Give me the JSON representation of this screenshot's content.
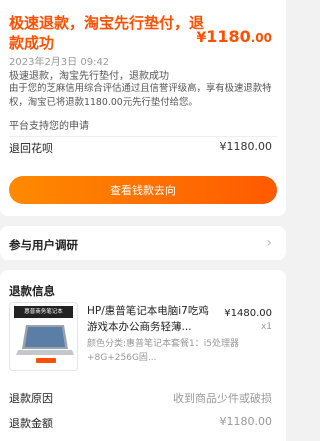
{
  "header": {
    "title": "极速退款，淘宝先行垫付，退款成功",
    "amount_currency": "¥",
    "amount_int": "1180",
    "amount_dec": ".00",
    "timestamp": "2023年2月3日 09:42",
    "subtitle": "极速退款，淘宝先行垫付，退款成功",
    "description": "由于您的芝麻信用综合评估通过且信誉评级高，享有极速退款特权，淘宝已将退款1180.00元先行垫付给您。",
    "platform_note": "平台支持您的申请",
    "refund_label": "退回花呗",
    "refund_value": "¥1180.00",
    "cta_label": "查看钱款去向"
  },
  "survey": {
    "title": "参与用户调研",
    "chevron": "›"
  },
  "refund_info": {
    "title": "退款信息",
    "product": {
      "thumb_text": "惠普商务笔记本",
      "title": "HP/惠普笔记本电脑i7吃鸡游戏本办公商务轻薄...",
      "price": "¥1480.00",
      "qty": "x1",
      "spec": "颜色分类:惠普笔记本套餐1：i5处理器+8G+256G固..."
    },
    "reason_label": "退款原因",
    "reason_value": "收到商品少件或破损",
    "amount_label": "退款金额",
    "amount_value": "¥1180.00"
  },
  "colors": {
    "accent": "#ff5000",
    "cta_start": "#ff8a00",
    "cta_end": "#ff5a00"
  }
}
